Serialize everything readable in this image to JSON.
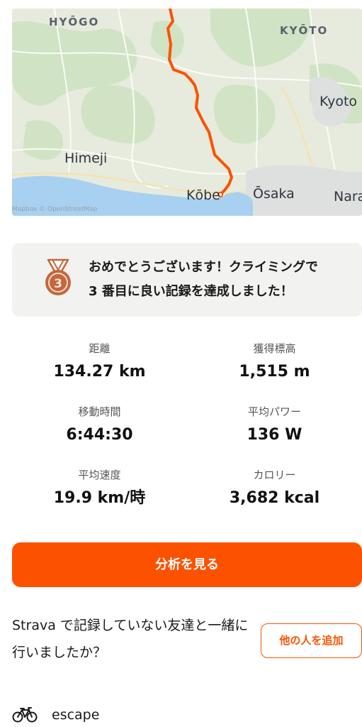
{
  "map": {
    "labels": {
      "hyogo": "HYŌGO",
      "kyoto_pref": "KYŌTO",
      "kyoto_city": "Kyoto",
      "himeji": "Himeji",
      "kobe": "Kōbe",
      "osaka": "Ōsaka",
      "nara": "Nara"
    },
    "attribution": "Mapbox © OpenStreetMap",
    "route_color": "#fc5200"
  },
  "achievement": {
    "icon": "bronze-medal-3-icon",
    "text": "おめでとうございます！クライミングで 3 番目に良い記録を達成しました！",
    "rank": "3"
  },
  "stats": [
    {
      "label": "距離",
      "value": "134.27 km"
    },
    {
      "label": "獲得標高",
      "value": "1,515 m"
    },
    {
      "label": "移動時間",
      "value": "6:44:30"
    },
    {
      "label": "平均パワー",
      "value": "136 W"
    },
    {
      "label": "平均速度",
      "value": "19.9 km/時"
    },
    {
      "label": "カロリー",
      "value": "3,682 kcal"
    }
  ],
  "analyze_button": "分析を見る",
  "friends": {
    "question": "Strava で記録していない友達と一緒に行いましたか？",
    "add_button": "他の人を追加"
  },
  "gear": {
    "icon": "bike-icon",
    "name": "escape"
  },
  "colors": {
    "accent": "#fc5200",
    "card_bg": "#f2f2f0"
  }
}
